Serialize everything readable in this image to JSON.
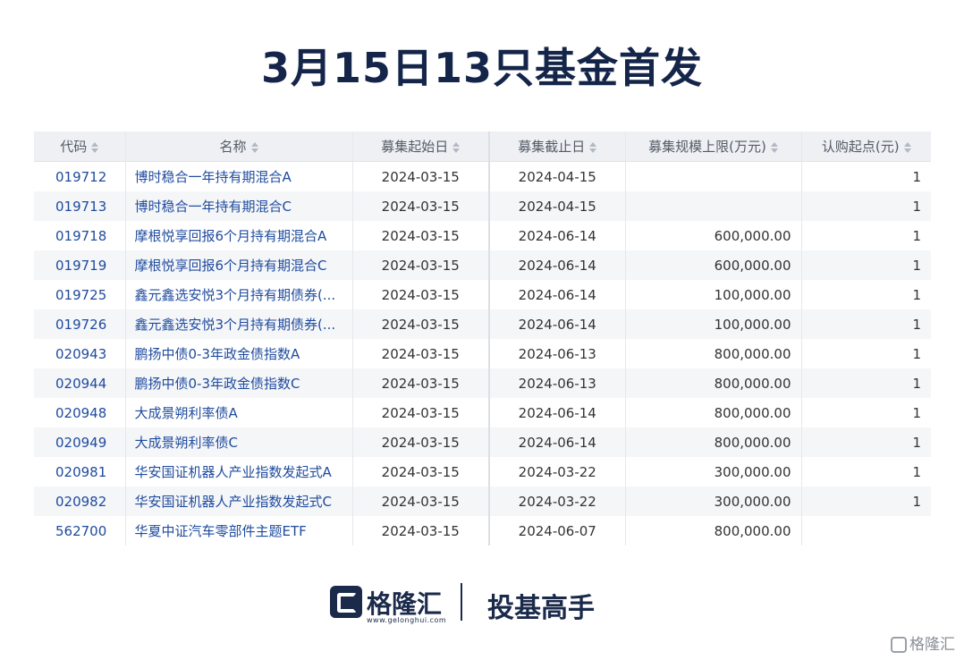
{
  "title": "3月15日13只基金首发",
  "columns": [
    "代码",
    "名称",
    "募集起始日",
    "募集截止日",
    "募集规模上限(万元)",
    "认购起点(元)"
  ],
  "rows": [
    {
      "code": "019712",
      "name": "博时稳合一年持有期混合A",
      "start": "2024-03-15",
      "end": "2024-04-15",
      "cap": "",
      "min": "1"
    },
    {
      "code": "019713",
      "name": "博时稳合一年持有期混合C",
      "start": "2024-03-15",
      "end": "2024-04-15",
      "cap": "",
      "min": "1"
    },
    {
      "code": "019718",
      "name": "摩根悦享回报6个月持有期混合A",
      "start": "2024-03-15",
      "end": "2024-06-14",
      "cap": "600,000.00",
      "min": "1"
    },
    {
      "code": "019719",
      "name": "摩根悦享回报6个月持有期混合C",
      "start": "2024-03-15",
      "end": "2024-06-14",
      "cap": "600,000.00",
      "min": "1"
    },
    {
      "code": "019725",
      "name": "鑫元鑫选安悦3个月持有期债券(...",
      "start": "2024-03-15",
      "end": "2024-06-14",
      "cap": "100,000.00",
      "min": "1"
    },
    {
      "code": "019726",
      "name": "鑫元鑫选安悦3个月持有期债券(...",
      "start": "2024-03-15",
      "end": "2024-06-14",
      "cap": "100,000.00",
      "min": "1"
    },
    {
      "code": "020943",
      "name": "鹏扬中债0-3年政金债指数A",
      "start": "2024-03-15",
      "end": "2024-06-13",
      "cap": "800,000.00",
      "min": "1"
    },
    {
      "code": "020944",
      "name": "鹏扬中债0-3年政金债指数C",
      "start": "2024-03-15",
      "end": "2024-06-13",
      "cap": "800,000.00",
      "min": "1"
    },
    {
      "code": "020948",
      "name": "大成景朔利率债A",
      "start": "2024-03-15",
      "end": "2024-06-14",
      "cap": "800,000.00",
      "min": "1"
    },
    {
      "code": "020949",
      "name": "大成景朔利率债C",
      "start": "2024-03-15",
      "end": "2024-06-14",
      "cap": "800,000.00",
      "min": "1"
    },
    {
      "code": "020981",
      "name": "华安国证机器人产业指数发起式A",
      "start": "2024-03-15",
      "end": "2024-03-22",
      "cap": "300,000.00",
      "min": "1"
    },
    {
      "code": "020982",
      "name": "华安国证机器人产业指数发起式C",
      "start": "2024-03-15",
      "end": "2024-03-22",
      "cap": "300,000.00",
      "min": "1"
    },
    {
      "code": "562700",
      "name": "华夏中证汽车零部件主题ETF",
      "start": "2024-03-15",
      "end": "2024-06-07",
      "cap": "800,000.00",
      "min": ""
    }
  ],
  "footer": {
    "logo_text": "格隆汇",
    "logo_url": "www.gelonghui.com",
    "slogan": "投基高手"
  },
  "watermark": "格隆汇",
  "icons": {
    "sort": "sort-icon",
    "logo": "gelonghui-logo-icon"
  },
  "colors": {
    "title": "#15254a",
    "link": "#1f4b9e",
    "header_bg": "#eef0f4",
    "stripe": "#f5f6f8"
  }
}
